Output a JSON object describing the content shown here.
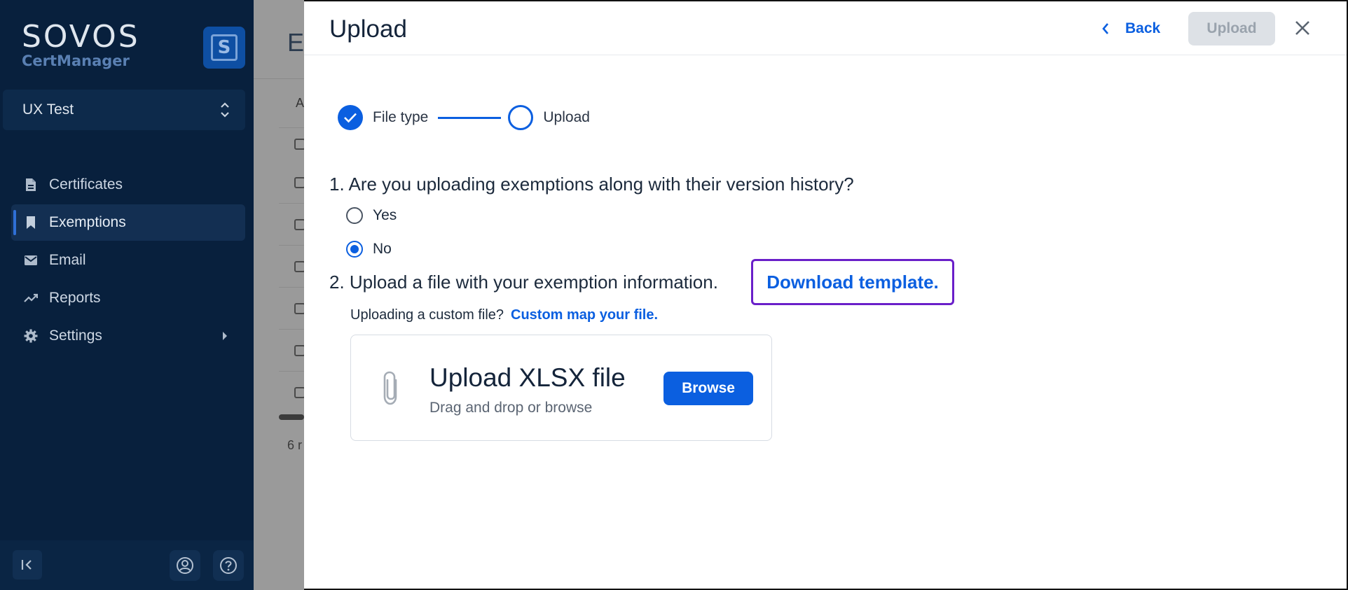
{
  "sidebar": {
    "logo_text": "SOVOS",
    "logo_subtext": "CertManager",
    "logo_badge": "S",
    "tenant": "UX Test",
    "items": [
      {
        "label": "Certificates",
        "icon": "document-icon"
      },
      {
        "label": "Exemptions",
        "icon": "bookmark-icon",
        "active": true
      },
      {
        "label": "Email",
        "icon": "mail-icon"
      },
      {
        "label": "Reports",
        "icon": "trending-icon"
      },
      {
        "label": "Settings",
        "icon": "gear-icon",
        "has_submenu": true
      }
    ]
  },
  "background_page": {
    "title_fragment": "E",
    "column_fragment": "A",
    "count_fragment": "6 r"
  },
  "drawer": {
    "title": "Upload",
    "back_label": "Back",
    "upload_label": "Upload",
    "steps": [
      {
        "label": "File type",
        "status": "complete"
      },
      {
        "label": "Upload",
        "status": "current"
      }
    ],
    "question1": "1. Are you uploading exemptions along with their version history?",
    "options": [
      {
        "label": "Yes",
        "selected": false
      },
      {
        "label": "No",
        "selected": true
      }
    ],
    "question2": "2. Upload a file with your exemption information.",
    "download_link": "Download template.",
    "custom_prompt": "Uploading a custom file?",
    "custom_link": "Custom map your file.",
    "dropzone": {
      "title": "Upload XLSX file",
      "subtitle": "Drag and drop or browse",
      "browse_label": "Browse"
    }
  },
  "colors": {
    "sidebar_bg": "#08203d",
    "accent": "#0b5fe0",
    "focus_ring": "#6a1fc9",
    "disabled_button": "#dde1e6"
  }
}
